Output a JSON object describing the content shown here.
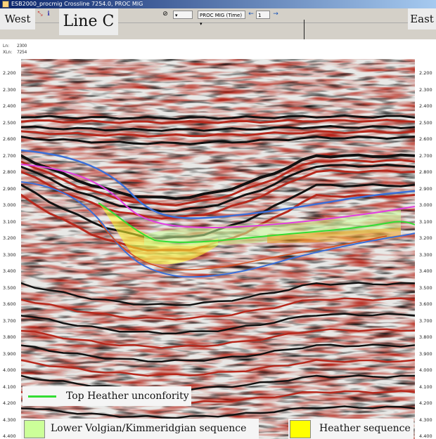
{
  "window": {
    "title": "ESB2000_procmig Crossline 7254.0, PROC MIG"
  },
  "toolbar": {
    "dropdown_value": "PROC MIG (Time)",
    "page_input_value": "1",
    "prev_arrow": "←",
    "next_arrow": "→"
  },
  "labels": {
    "west": "West",
    "east": "East",
    "line": "Line C"
  },
  "header": {
    "ln_label": "Ln:",
    "xln_label": "XLn:",
    "ln_value": "2300",
    "xln_value": "7254"
  },
  "axis": {
    "time_ticks": [
      "2.200",
      "2.300",
      "2.400",
      "2.500",
      "2.600",
      "2.700",
      "2.800",
      "2.900",
      "3.000",
      "3.100",
      "3.200",
      "3.300",
      "3.400",
      "3.500",
      "3.600",
      "3.700",
      "3.800",
      "3.900",
      "4.000",
      "4.100",
      "4.200",
      "4.300",
      "4.400"
    ]
  },
  "legend": [
    {
      "label": "Top Heather unconfority",
      "color": "#33dd33"
    },
    {
      "label": "Lower Volgian/Kimmeridgian sequence",
      "color": "#ccff99"
    },
    {
      "label": "Heather sequence",
      "color": "#ffff00"
    }
  ],
  "horizon_colors": {
    "blue": "#3a6fd8",
    "magenta": "#e23de0",
    "green": "#33dd33",
    "orange": "#f0a020",
    "yellow": "#ffff30"
  }
}
